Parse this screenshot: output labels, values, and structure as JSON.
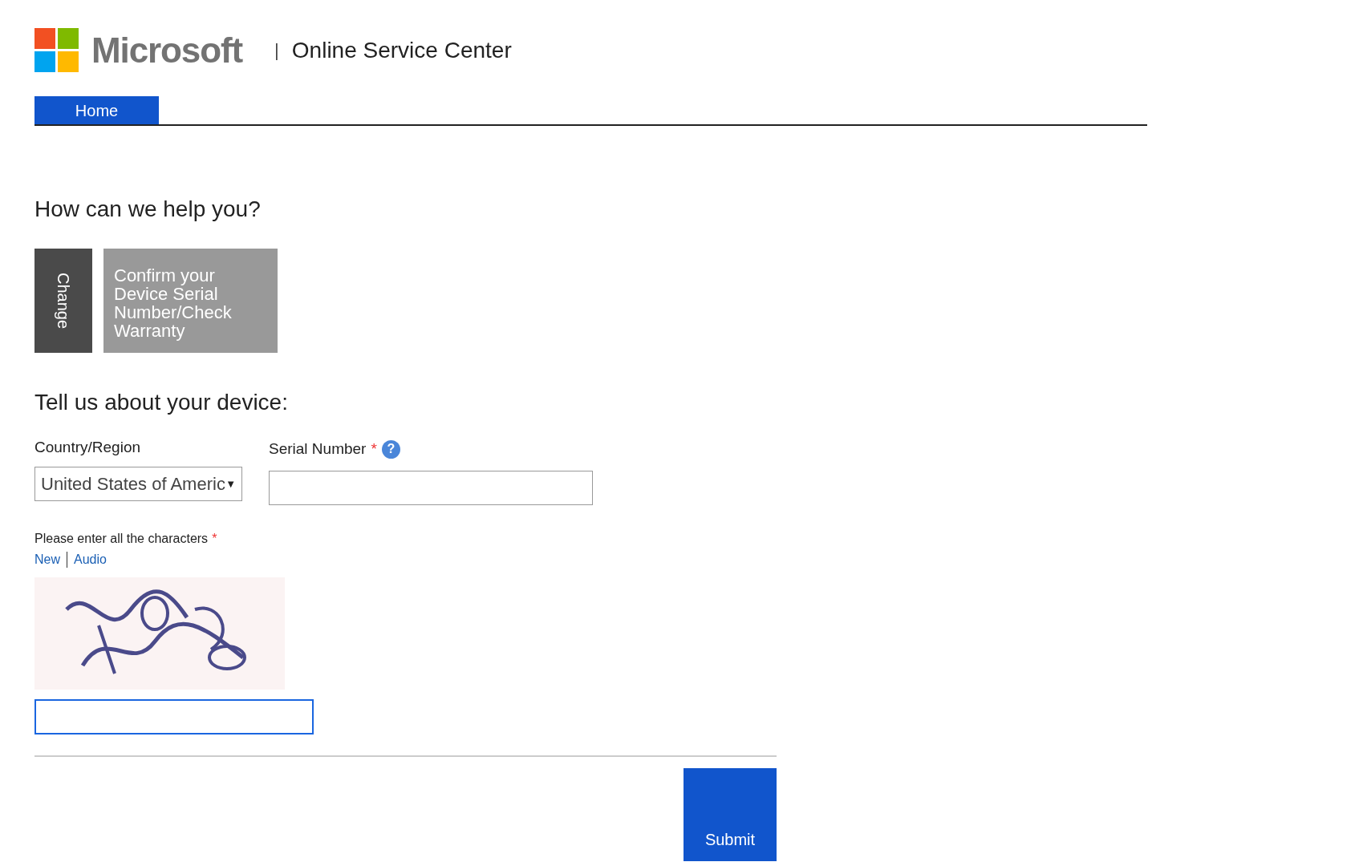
{
  "header": {
    "brand": "Microsoft",
    "separator": "|",
    "title": "Online Service Center"
  },
  "tabs": [
    {
      "label": "Home",
      "selected": true
    }
  ],
  "heading": "How can we help you?",
  "tiles": [
    {
      "kind": "change",
      "label": "Change"
    },
    {
      "kind": "option",
      "label": "Confirm your Device Serial Number/Check Warranty"
    }
  ],
  "form_heading": "Tell us about your device:",
  "country": {
    "label": "Country/Region",
    "value": "United States of Americ",
    "arrow": "▼"
  },
  "serial": {
    "label": "Serial Number",
    "required_mark": "*",
    "help": "?"
  },
  "captcha": {
    "label": "Please enter all the characters",
    "required_mark": "*",
    "links": [
      "New",
      "Audio"
    ],
    "focused": true
  },
  "submit": "Submit"
}
